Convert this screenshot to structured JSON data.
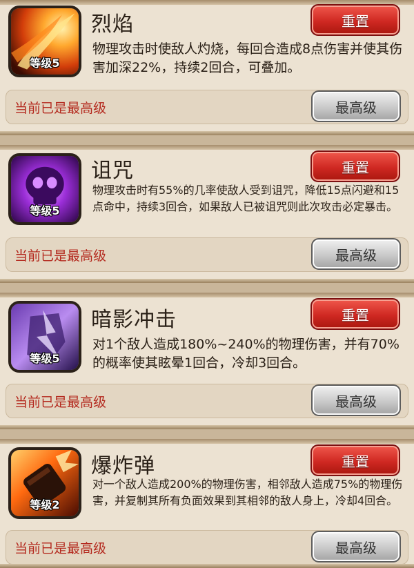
{
  "reset_label": "重置",
  "max_label": "最高级",
  "status_text": "当前已是最高级",
  "skills": [
    {
      "name": "烈焰",
      "level": "等级5",
      "icon": "fire-slash-icon",
      "description": "物理攻击时使敌人灼烧，每回合造成8点伤害并使其伤害加深22%，持续2回合，可叠加。"
    },
    {
      "name": "诅咒",
      "level": "等级5",
      "icon": "purple-skull-icon",
      "description": "物理攻击时有55%的几率使敌人受到诅咒，降低15点闪避和15点命中，持续3回合，如果敌人已被诅咒则此次攻击必定暴击。"
    },
    {
      "name": "暗影冲击",
      "level": "等级5",
      "icon": "shadow-strike-icon",
      "description": "对1个敌人造成180%~240%的物理伤害，并有70%的概率使其眩晕1回合，冷却3回合。"
    },
    {
      "name": "爆炸弹",
      "level": "等级2",
      "icon": "bomb-icon",
      "description": "对一个敌人造成200%的物理伤害，相邻敌人造成75%的物理伤害，并复制其所有负面效果到其相邻的敌人身上，冷却4回合。"
    }
  ],
  "colors": {
    "reset_button": "#cf2822",
    "max_button": "#c9c9c9",
    "status_text": "#b42a1f",
    "card_background": "#ece2d2"
  }
}
